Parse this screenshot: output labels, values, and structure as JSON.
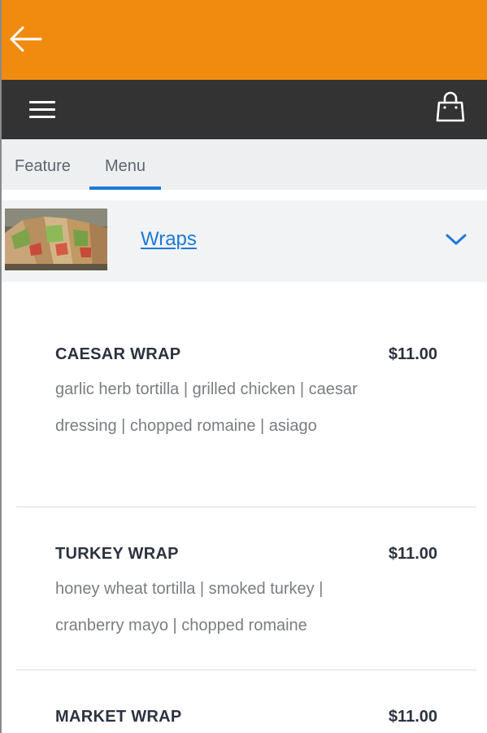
{
  "header": {
    "back_icon": "arrow-left-icon",
    "menu_icon": "hamburger-icon",
    "cart_icon": "shopping-bag-icon",
    "accent_color": "#f18b10",
    "navbar_color": "#333333"
  },
  "tabs": [
    {
      "label": "Feature",
      "active": false
    },
    {
      "label": "Menu",
      "active": true
    }
  ],
  "category": {
    "label": "Wraps",
    "thumbnail": "wraps-photo",
    "expand_icon": "chevron-down-icon",
    "link_color": "#1d7ad6"
  },
  "items": [
    {
      "name": "CAESAR WRAP",
      "price": "$11.00",
      "description": "garlic herb tortilla | grilled chicken | caesar dressing | chopped romaine | asiago"
    },
    {
      "name": "TURKEY WRAP",
      "price": "$11.00",
      "description": "honey wheat tortilla | smoked turkey | cranberry mayo | chopped romaine"
    },
    {
      "name": "MARKET WRAP",
      "price": "$11.00",
      "description": ""
    }
  ]
}
